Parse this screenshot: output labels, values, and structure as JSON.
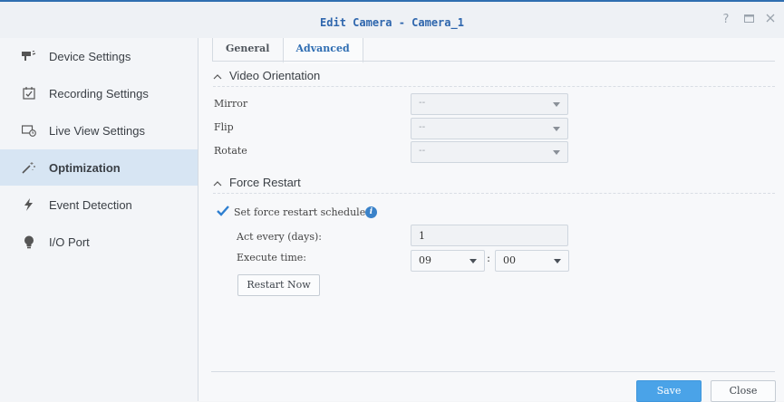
{
  "window": {
    "title": "Edit Camera - Camera_1"
  },
  "sidebar": {
    "items": [
      {
        "label": "Device Settings",
        "icon": "camera-icon",
        "active": false
      },
      {
        "label": "Recording Settings",
        "icon": "calendar-check-icon",
        "active": false
      },
      {
        "label": "Live View Settings",
        "icon": "monitor-clock-icon",
        "active": false
      },
      {
        "label": "Optimization",
        "icon": "magic-wand-icon",
        "active": true
      },
      {
        "label": "Event Detection",
        "icon": "lightning-icon",
        "active": false
      },
      {
        "label": "I/O Port",
        "icon": "lightbulb-icon",
        "active": false
      }
    ]
  },
  "tabs": [
    {
      "label": "General",
      "active": false
    },
    {
      "label": "Advanced",
      "active": true
    }
  ],
  "video_orientation": {
    "title": "Video Orientation",
    "fields": [
      {
        "label": "Mirror",
        "value": "--"
      },
      {
        "label": "Flip",
        "value": "--"
      },
      {
        "label": "Rotate",
        "value": "--"
      }
    ]
  },
  "force_restart": {
    "title": "Force Restart",
    "schedule_label": "Set force restart schedule",
    "schedule_checked": true,
    "act_every_label": "Act every (days):",
    "act_every_value": "1",
    "execute_time_label": "Execute time:",
    "hour_value": "09",
    "time_separator": ":",
    "minute_value": "00",
    "restart_now_label": "Restart Now"
  },
  "footer": {
    "save_label": "Save",
    "close_label": "Close"
  },
  "colors": {
    "accent": "#2e6db2",
    "active_bg": "#d7e5f3",
    "save_button": "#4aa3e8"
  }
}
